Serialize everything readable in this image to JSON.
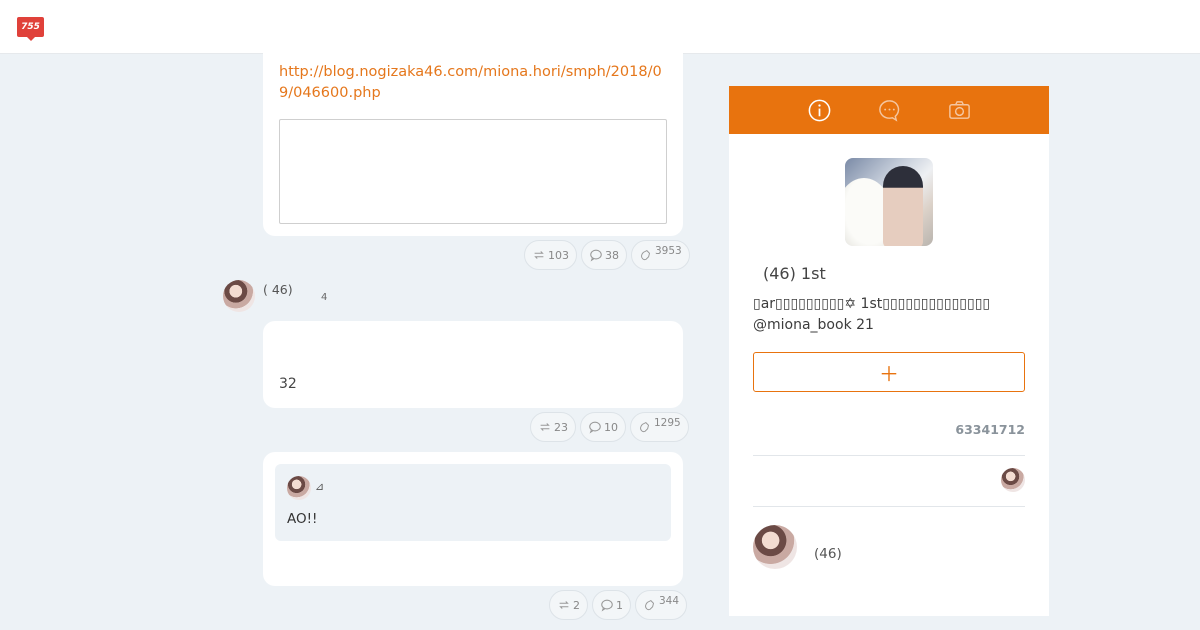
{
  "header": {
    "logo_text": "755"
  },
  "posts": [
    {
      "link": "http://blog.nogizaka46.com/miona.hori/smph/2018/09/046600.php",
      "actions": {
        "repost": "103",
        "comment": "38",
        "like": "3953"
      }
    },
    {
      "author": "( 46)",
      "time": "4",
      "body": "32",
      "actions": {
        "repost": "23",
        "comment": "10",
        "like": "1295"
      }
    },
    {
      "quote_mark": "⊿",
      "quote_text": "AO!!",
      "actions": {
        "repost": "2",
        "comment": "1",
        "like": "344"
      }
    }
  ],
  "sidebar": {
    "tabs": [
      "info-icon",
      "chat-icon",
      "camera-icon"
    ],
    "profile_name": "(46) 1st",
    "bio": "▯ar▯▯▯▯▯▯▯▯▯✡ 1st▯▯▯▯▯▯▯▯▯▯▯▯▯▯ @miona_book 21",
    "follow_label": "＋",
    "followers": "63341712",
    "recommended_name": "(46)"
  },
  "colors": {
    "accent": "#e8730e",
    "link": "#e5771c",
    "background": "#edf2f6"
  }
}
